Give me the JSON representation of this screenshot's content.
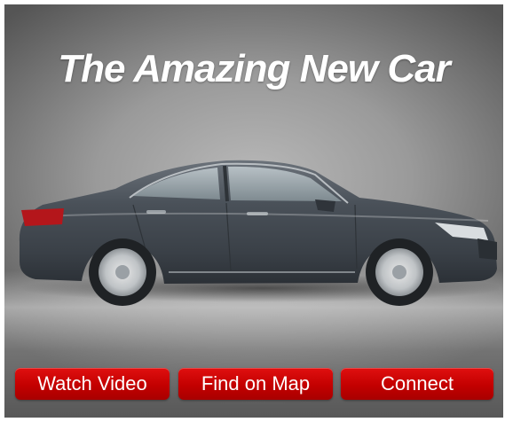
{
  "hero": {
    "title": "The Amazing New Car"
  },
  "buttons": {
    "watch_video": "Watch Video",
    "find_on_map": "Find on Map",
    "connect": "Connect"
  },
  "colors": {
    "button_red": "#c30000",
    "title_text": "#ffffff",
    "car_body": "#4a5159"
  },
  "icons": {
    "car_image": "sedan-side-view"
  }
}
